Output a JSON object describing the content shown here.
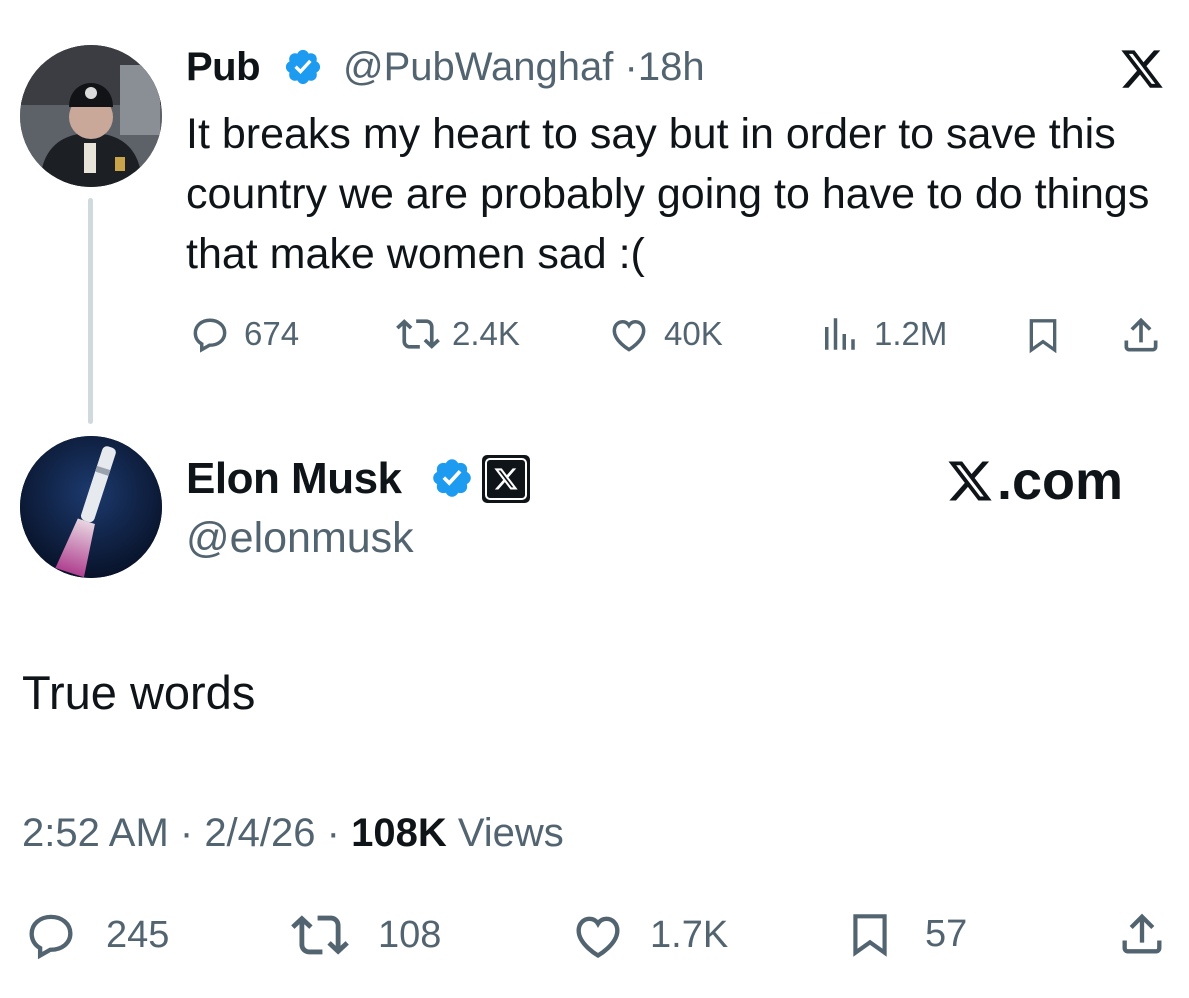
{
  "quoted_post": {
    "display_name": "Pub",
    "handle": "@PubWanghaf",
    "separator": "·",
    "time_ago": "18h",
    "verified": true,
    "text": "It breaks my heart to say but in order to save this country we are probably going to have to do things that make women sad :(",
    "replies": "674",
    "reposts": "2.4K",
    "likes": "40K",
    "views": "1.2M"
  },
  "post": {
    "display_name": "Elon Musk",
    "handle": "@elonmusk",
    "verified": true,
    "affiliation_badge": "X",
    "brand_link": ".com",
    "text": "True words",
    "time": "2:52 AM",
    "date": "2/4/26",
    "views_count": "108K",
    "views_label": "Views",
    "replies": "245",
    "reposts": "108",
    "likes": "1.7K",
    "bookmarks": "57"
  },
  "colors": {
    "text_primary": "#0f1419",
    "text_secondary": "#536471",
    "verified_blue": "#1d9bf0",
    "thread_line": "#cfd9de"
  },
  "icons": [
    "reply-icon",
    "repost-icon",
    "like-icon",
    "views-icon",
    "bookmark-icon",
    "share-icon",
    "verified-badge-icon",
    "x-logo-icon"
  ]
}
